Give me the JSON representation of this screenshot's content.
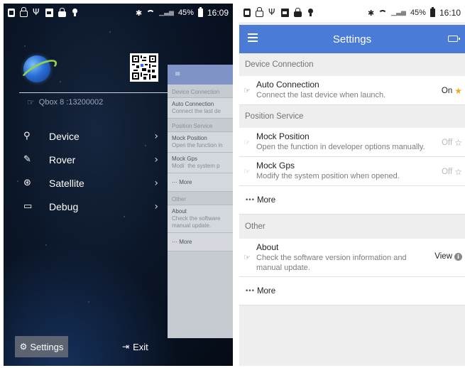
{
  "left_screen": {
    "status_bar": {
      "battery_percent": "45%",
      "time": "16:09"
    },
    "device_label": "Qbox 8 :13200002",
    "menu_items": [
      {
        "label": "Device",
        "icon": "link-icon"
      },
      {
        "label": "Rover",
        "icon": "edit-icon"
      },
      {
        "label": "Satellite",
        "icon": "satellite-icon"
      },
      {
        "label": "Debug",
        "icon": "laptop-icon"
      }
    ],
    "settings_button": "Settings",
    "exit_button": "Exit",
    "preview": {
      "sections": [
        "Device Connection",
        "Position Service",
        "Other"
      ],
      "items": [
        {
          "title": "Auto Connection",
          "desc": "Connect the last de"
        },
        {
          "title": "Mock Position",
          "desc": "Open the function in"
        },
        {
          "title": "Mock Gps",
          "desc": "Modiʿ the system p"
        },
        {
          "title": "About",
          "desc": "Check the software",
          "desc2": "manual update."
        }
      ],
      "more_label": "More"
    }
  },
  "right_screen": {
    "status_bar": {
      "battery_percent": "45%",
      "time": "16:10"
    },
    "title": "Settings",
    "sections": {
      "device_connection": {
        "header": "Device Connection",
        "rows": [
          {
            "title": "Auto Connection",
            "desc": "Connect the last device when launch.",
            "value": "On"
          }
        ]
      },
      "position_service": {
        "header": "Position Service",
        "rows": [
          {
            "title": "Mock Position",
            "desc": "Open the function in developer options manually.",
            "value": "Off"
          },
          {
            "title": "Mock Gps",
            "desc": "Modify the system position when opened.",
            "value": "Off"
          }
        ],
        "more_label": "More"
      },
      "other": {
        "header": "Other",
        "rows": [
          {
            "title": "About",
            "desc_line1": "Check the software version information and",
            "desc_line2": "manual update.",
            "value": "View"
          }
        ],
        "more_label": "More"
      }
    }
  },
  "colors": {
    "accent_blue": "#4a7bd6",
    "star_gold": "#f1a91c",
    "drawer_bg": "#0b1628"
  }
}
